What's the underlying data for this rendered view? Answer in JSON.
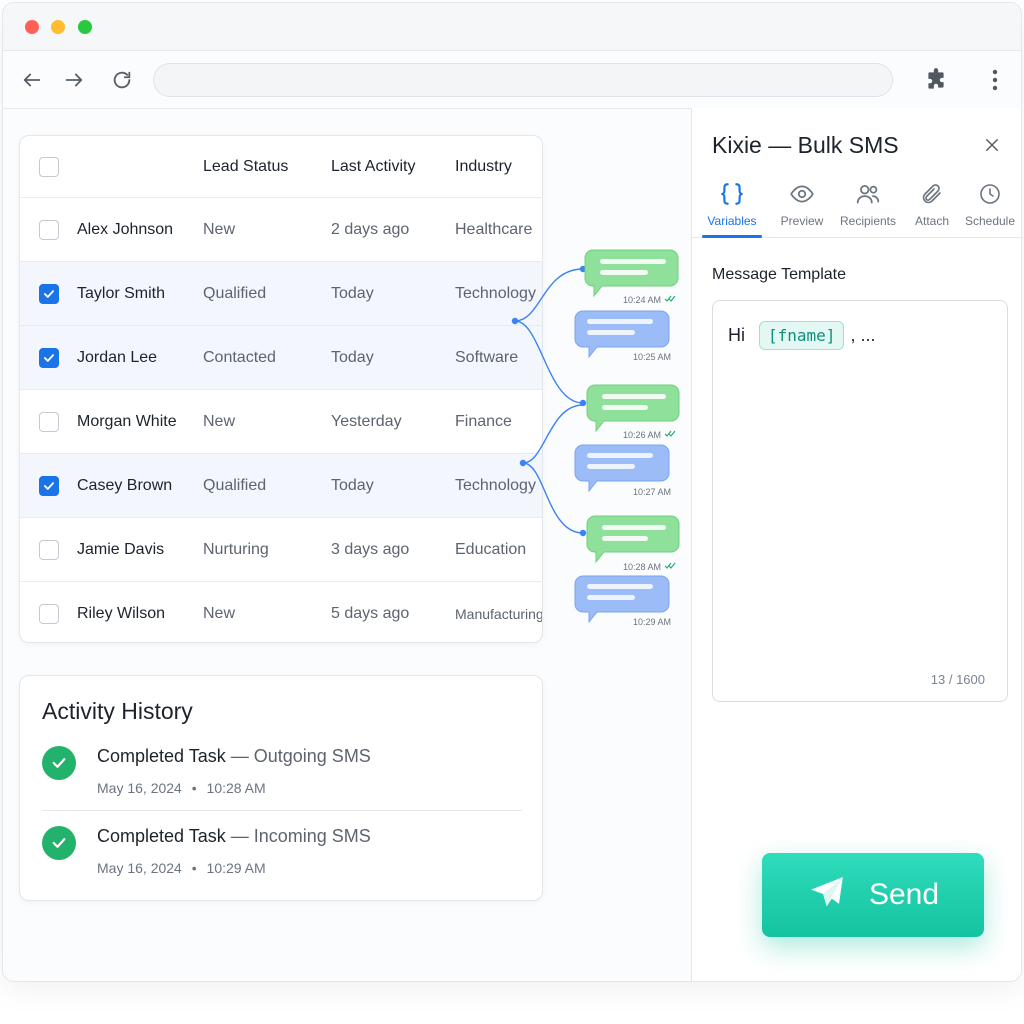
{
  "browser": {
    "window_controls": [
      "close",
      "minimize",
      "maximize"
    ],
    "nav_icons": [
      "back-arrow-icon",
      "forward-arrow-icon",
      "reload-icon"
    ],
    "address_value": "",
    "toolbar_icons": [
      "extensions-puzzle-icon",
      "more-vertical-icon"
    ]
  },
  "leads_table": {
    "columns": [
      "",
      "Lead Status",
      "Last Activity",
      "Industry"
    ],
    "rows": [
      {
        "name": "Alex Johnson",
        "status": "New",
        "activity": "2 days ago",
        "industry": "Healthcare",
        "selected": false
      },
      {
        "name": "Taylor Smith",
        "status": "Qualified",
        "activity": "Today",
        "industry": "Technology",
        "selected": true
      },
      {
        "name": "Jordan Lee",
        "status": "Contacted",
        "activity": "Today",
        "industry": "Software",
        "selected": true
      },
      {
        "name": "Morgan White",
        "status": "New",
        "activity": "Yesterday",
        "industry": "Finance",
        "selected": false
      },
      {
        "name": "Casey Brown",
        "status": "Qualified",
        "activity": "Today",
        "industry": "Technology",
        "selected": true
      },
      {
        "name": "Jamie Davis",
        "status": "Nurturing",
        "activity": "3 days ago",
        "industry": "Education",
        "selected": false
      },
      {
        "name": "Riley Wilson",
        "status": "New",
        "activity": "5 days ago",
        "industry": "Manufacturing",
        "selected": false
      }
    ]
  },
  "message_bubbles": [
    {
      "type": "outgoing",
      "time": "10:24 AM",
      "read": true
    },
    {
      "type": "incoming",
      "time": "10:25 AM",
      "read": false
    },
    {
      "type": "outgoing",
      "time": "10:26 AM",
      "read": true
    },
    {
      "type": "incoming",
      "time": "10:27 AM",
      "read": false
    },
    {
      "type": "outgoing",
      "time": "10:28 AM",
      "read": true
    },
    {
      "type": "incoming",
      "time": "10:29 AM",
      "read": false
    }
  ],
  "activity": {
    "title": "Activity History",
    "items": [
      {
        "title": "Completed Task",
        "subtitle": "— Outgoing SMS",
        "date": "May 16, 2024",
        "time": "10:28 AM"
      },
      {
        "title": "Completed Task",
        "subtitle": "— Incoming SMS",
        "date": "May 16, 2024",
        "time": "10:29 AM"
      }
    ],
    "separator": "•"
  },
  "panel": {
    "title": "Kixie — Bulk SMS",
    "tabs": [
      {
        "label": "Variables",
        "icon": "braces-icon",
        "active": true
      },
      {
        "label": "Preview",
        "icon": "eye-icon",
        "active": false
      },
      {
        "label": "Recipients",
        "icon": "users-icon",
        "active": false
      },
      {
        "label": "Attach",
        "icon": "paperclip-icon",
        "active": false
      },
      {
        "label": "Schedule",
        "icon": "clock-icon",
        "active": false
      }
    ],
    "field_label": "Message Template",
    "template": {
      "prefix": "Hi",
      "variable": "[fname]",
      "suffix": ", ..."
    },
    "char_count": "13 / 1600",
    "send_label": "Send"
  },
  "colors": {
    "accent": "#1a73e8",
    "send": "#14c3a0",
    "success": "#22b26b",
    "outgoing_bubble": "#8fe09a",
    "incoming_bubble": "#9bbcf7"
  }
}
